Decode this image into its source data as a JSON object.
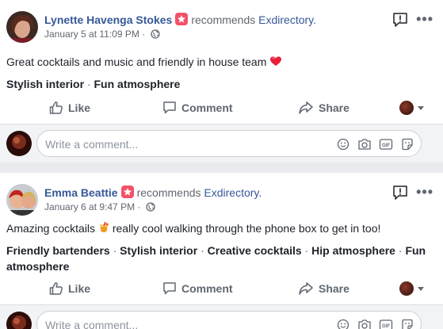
{
  "posts": [
    {
      "author": "Lynette Havenga Stokes",
      "recommends_text": "recommends",
      "page_name": "Exdirectory.",
      "timestamp": "January 5 at 11:09 PM",
      "separator": "·",
      "body": "Great cocktails and music and friendly in house team",
      "body_emoji": "heart-icon",
      "tags": [
        "Stylish interior",
        "Fun atmosphere"
      ],
      "actions": {
        "like": "Like",
        "comment": "Comment",
        "share": "Share"
      },
      "comment_placeholder": "Write a comment..."
    },
    {
      "author": "Emma Beattie",
      "recommends_text": "recommends",
      "page_name": "Exdirectory.",
      "timestamp": "January 6 at 9:47 PM",
      "separator": "·",
      "body_before": "Amazing cocktails",
      "body_emoji": "cocktail-icon",
      "body_after": "really cool walking through the phone box to get in too!",
      "tags": [
        "Friendly bartenders",
        "Stylish interior",
        "Creative cocktails",
        "Hip atmosphere",
        "Fun atmosphere"
      ],
      "actions": {
        "like": "Like",
        "comment": "Comment",
        "share": "Share"
      },
      "comment_placeholder": "Write a comment..."
    }
  ],
  "tag_separator": " · ",
  "colors": {
    "link": "#365899",
    "recommend_badge": "#f25268",
    "muted": "#606770",
    "background": "#e9ebee"
  }
}
